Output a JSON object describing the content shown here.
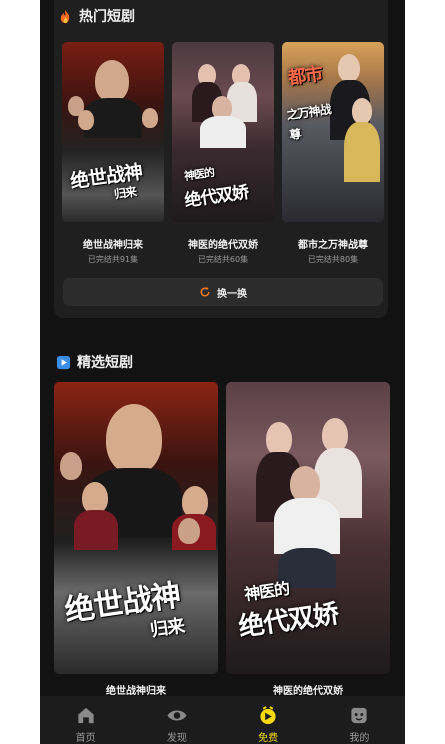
{
  "hot": {
    "title": "热门短剧",
    "dramas": [
      {
        "name": "绝世战神归来",
        "episodes": "已完结共91集",
        "poster_title": "绝世战神",
        "poster_sub": "归来"
      },
      {
        "name": "神医的绝代双娇",
        "episodes": "已完结共60集",
        "poster_title": "神医的",
        "poster_sub": "绝代双娇"
      },
      {
        "name": "都市之万神战尊",
        "episodes": "已完结共80集",
        "poster_title": "都市",
        "poster_sub": "之万神战尊"
      }
    ],
    "refresh_label": "换一换"
  },
  "picks": {
    "title": "精选短剧",
    "dramas": [
      {
        "name": "绝世战神归来",
        "poster_title": "绝世战神",
        "poster_sub": "归来"
      },
      {
        "name": "神医的绝代双娇",
        "poster_title": "神医的",
        "poster_sub": "绝代双娇"
      }
    ]
  },
  "tabbar": {
    "items": [
      {
        "label": "首页",
        "icon": "home-icon"
      },
      {
        "label": "发现",
        "icon": "eye-icon"
      },
      {
        "label": "免费",
        "icon": "free-icon"
      },
      {
        "label": "我的",
        "icon": "profile-icon"
      }
    ],
    "active_color": "#f5d90a"
  }
}
